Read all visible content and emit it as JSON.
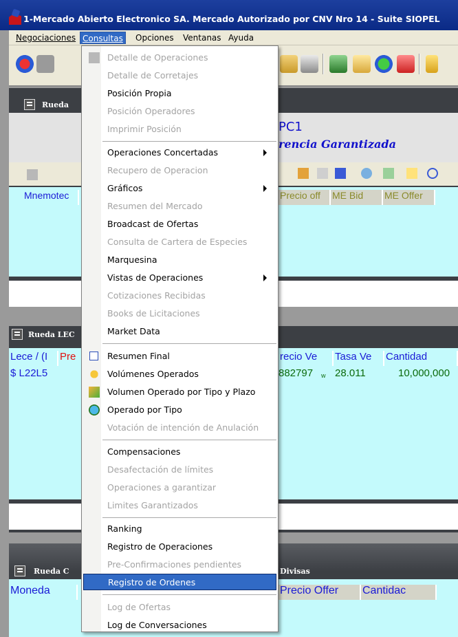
{
  "window": {
    "title": "1-Mercado Abierto Electronico SA. Mercado Autorizado por CNV Nro 14 - Suite SIOPEL"
  },
  "menubar": [
    {
      "label": "Negociaciones"
    },
    {
      "label": "Consultas"
    },
    {
      "label": "Opciones"
    },
    {
      "label": "Ventanas"
    },
    {
      "label": "Ayuda"
    }
  ],
  "windows": {
    "rueda1": {
      "title": "Rueda",
      "header_line1": "PC1",
      "header_line2": "rencia Garantizada",
      "columns": [
        "Mnemotec",
        "Precio off",
        "ME Bid",
        "ME Offer"
      ]
    },
    "rueda2": {
      "title": "Rueda LEC",
      "columns": [
        "Lece / (I",
        "Pre",
        "recio Ve",
        "Tasa Ve",
        "Cantidad"
      ],
      "row": {
        "symbol": "$ L22L5",
        "price": "882797",
        "price_marker": "w",
        "rate": "28.011",
        "quantity": "10,000,000"
      }
    },
    "rueda3": {
      "title": "Rueda C",
      "title_tail": "Divisas",
      "columns": [
        "Moneda",
        "Precio Offer",
        "Cantidac"
      ]
    }
  },
  "consultas_menu": [
    {
      "label": "Detalle de Operaciones",
      "disabled": true,
      "icon": "doc-icon"
    },
    {
      "label": "Detalle de Corretajes",
      "disabled": true
    },
    {
      "label": "Posición Propia",
      "disabled": false
    },
    {
      "label": "Posición Operadores",
      "disabled": true
    },
    {
      "label": "Imprimir Posición",
      "disabled": true
    },
    {
      "label": "Operaciones Concertadas",
      "disabled": false,
      "submenu": true
    },
    {
      "label": "Recupero de Operacion",
      "disabled": true
    },
    {
      "label": "Gráficos",
      "disabled": false,
      "submenu": true
    },
    {
      "label": "Resumen del Mercado",
      "disabled": true
    },
    {
      "label": "Broadcast de Ofertas",
      "disabled": false
    },
    {
      "label": "Consulta de Cartera de Especies",
      "disabled": true
    },
    {
      "label": "Marquesina",
      "disabled": false
    },
    {
      "label": "Vistas de Operaciones",
      "disabled": false,
      "submenu": true
    },
    {
      "label": "Cotizaciones Recibidas",
      "disabled": true
    },
    {
      "label": "Books de Licitaciones",
      "disabled": true
    },
    {
      "label": "Market Data",
      "disabled": false
    },
    {
      "label": "Resumen Final",
      "disabled": false,
      "icon": "report-icon"
    },
    {
      "label": "Volúmenes Operados",
      "disabled": false,
      "icon": "coins-icon"
    },
    {
      "label": "Volumen Operado por Tipo y Plazo",
      "disabled": false,
      "icon": "hand-coins-icon"
    },
    {
      "label": "Operado por Tipo",
      "disabled": false,
      "icon": "globe-icon"
    },
    {
      "label": "Votación de intención de Anulación",
      "disabled": true
    },
    {
      "label": "Compensaciones",
      "disabled": false
    },
    {
      "label": "Desafectación de límites",
      "disabled": true
    },
    {
      "label": "Operaciones a garantizar",
      "disabled": true
    },
    {
      "label": "Limites Garantizados",
      "disabled": true
    },
    {
      "label": "Ranking",
      "disabled": false
    },
    {
      "label": "Registro de Operaciones",
      "disabled": false
    },
    {
      "label": "Pre-Confirmaciones pendientes",
      "disabled": true
    },
    {
      "label": "Registro de Ordenes",
      "disabled": false,
      "highlighted": true
    },
    {
      "label": "Log de Ofertas",
      "disabled": true
    },
    {
      "label": "Log de Conversaciones",
      "disabled": false
    }
  ],
  "colors": {
    "title_bar": "#0a2a86",
    "menu_highlight": "#316ac5",
    "grid_bg": "#c4fafc",
    "header_text": "#1a1ad6",
    "disabled_text": "#a3a3a3"
  }
}
